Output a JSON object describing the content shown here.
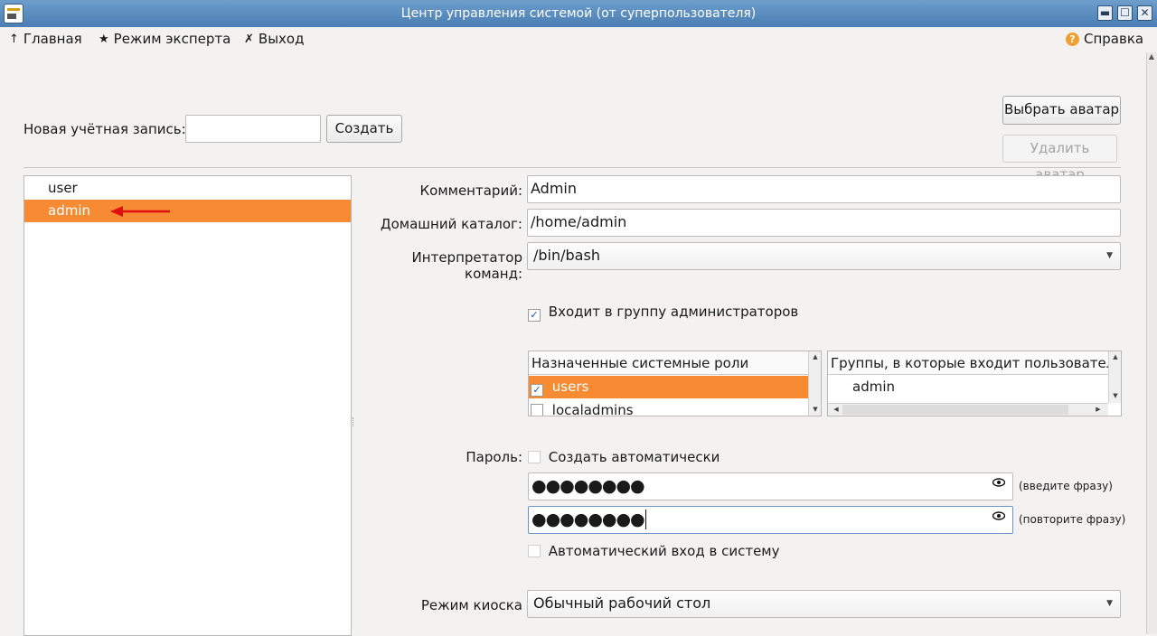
{
  "window": {
    "title": "Центр управления системой (от суперпользователя)",
    "controls": {
      "minimize": "▬",
      "maximize": "☐",
      "close": "✕"
    }
  },
  "toolbar": {
    "home": {
      "icon": "↑",
      "label": "Главная"
    },
    "expert": {
      "icon": "★",
      "label": "Режим эксперта"
    },
    "exit": {
      "icon": "✗",
      "label": "Выход"
    },
    "help": {
      "icon": "?",
      "label": "Справка"
    }
  },
  "new_account": {
    "label": "Новая учётная запись:",
    "value": "",
    "create_button": "Создать"
  },
  "avatar": {
    "choose_button": "Выбрать аватар",
    "delete_button": "Удалить аватар"
  },
  "users": {
    "items": [
      {
        "name": "user",
        "selected": false
      },
      {
        "name": "admin",
        "selected": true
      }
    ]
  },
  "form": {
    "comment": {
      "label": "Комментарий:",
      "value": "Admin"
    },
    "home_dir": {
      "label": "Домашний каталог:",
      "value": "/home/admin"
    },
    "shell": {
      "label": "Интерпретатор команд:",
      "value": "/bin/bash"
    },
    "admin_group": {
      "label": "Входит в группу администраторов",
      "checked": true,
      "check_glyph": "✓"
    },
    "roles": {
      "header": "Назначенные системные роли",
      "items": [
        {
          "label": "users",
          "checked": true,
          "selected": true
        },
        {
          "label": "localadmins",
          "checked": false,
          "selected": false
        }
      ]
    },
    "groups": {
      "header": "Группы, в которые входит пользовател",
      "items": [
        "admin"
      ]
    },
    "password": {
      "label": "Пароль:",
      "auto_label": "Создать автоматически",
      "value1": "●●●●●●●●",
      "hint1": "(введите фразу)",
      "value2": "●●●●●●●●",
      "hint2": "(повторите фразу)"
    },
    "autologin": {
      "label": "Автоматический вход в систему",
      "checked": false
    },
    "kiosk": {
      "label": "Режим киоска",
      "value": "Обычный рабочий стол"
    }
  },
  "colors": {
    "selection": "#f68b34",
    "titlebar": "#4a7db4",
    "annotation_arrow": "#e01010"
  },
  "icons": {
    "down_arrow": "▼",
    "up_arrow": "▲",
    "left_arrow": "◀",
    "right_arrow": "▶"
  }
}
